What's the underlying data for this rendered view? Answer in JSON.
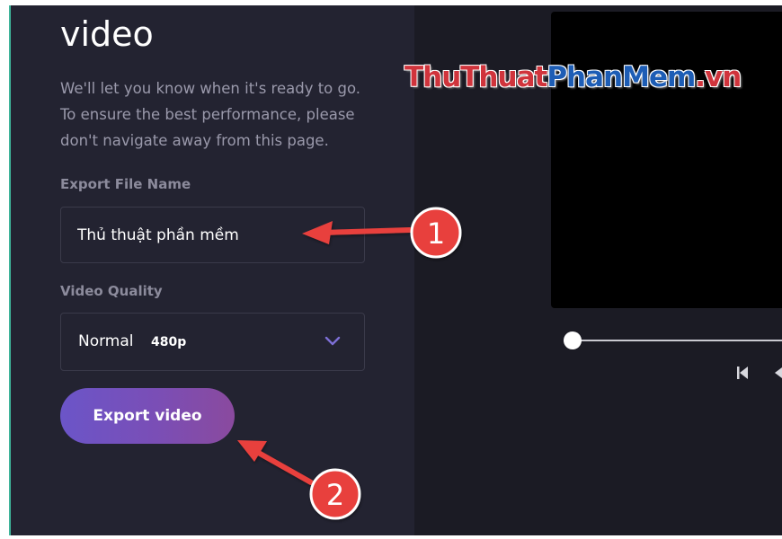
{
  "export_panel": {
    "title": "video",
    "description": "We'll let you know when it's ready to go. To ensure the best performance, please don't navigate away from this page.",
    "file_name_label": "Export File Name",
    "file_name_value": "Thủ thuật phần mềm",
    "quality_label": "Video Quality",
    "quality_value": "Normal",
    "quality_resolution": "480p",
    "export_button_label": "Export video"
  },
  "player": {
    "controls": [
      "skip-to-start-icon",
      "rewind-icon"
    ]
  },
  "watermark": {
    "part1": "ThuThuat",
    "part2": "PhanMem",
    "part3": ".vn"
  },
  "annotations": {
    "step1": "1",
    "step2": "2"
  },
  "colors": {
    "panel_background": "#232331",
    "preview_background": "#1b1b24",
    "button_gradient_start": "#6b55c8",
    "button_gradient_end": "#8a4a9e",
    "annotation_red": "#e8403c"
  }
}
